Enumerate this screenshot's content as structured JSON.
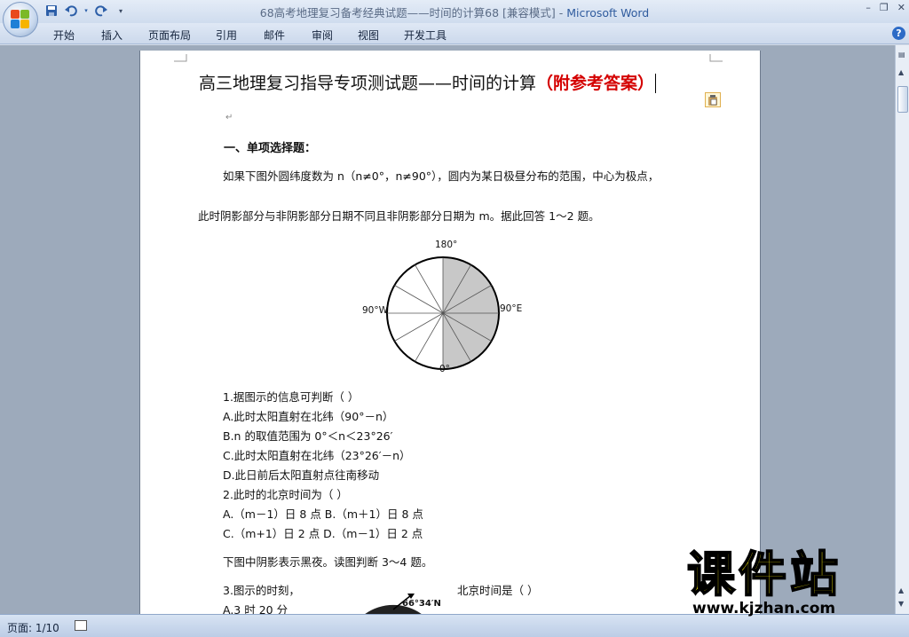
{
  "window": {
    "title": "68高考地理复习备考经典试题——时间的计算68 [兼容模式] - ",
    "app_name": "Microsoft Word",
    "minimize": "–",
    "restore": "❐",
    "close": "✕"
  },
  "ribbon": {
    "tabs": [
      "开始",
      "插入",
      "页面布局",
      "引用",
      "邮件",
      "审阅",
      "视图",
      "开发工具"
    ],
    "help": "?"
  },
  "document": {
    "title_main": "高三地理复习指导专项测试题——时间的计算",
    "title_answer": "（附参考答案）",
    "section1": "一、单项选择题：",
    "intro_line1": "如果下图外圆纬度数为 n（n≠0°，n≠90°），圆内为某日极昼分布的范围，中心为极点，",
    "intro_line2": "此时阴影部分与非阴影部分日期不同且非阴影部分日期为 m。据此回答 1～2 题。",
    "diagram_labels": {
      "top": "180°",
      "left": "90°W",
      "right": "90°E",
      "bottom": "0°"
    },
    "questions": [
      "1.据图示的信息可判断（      ）",
      "A.此时太阳直射在北纬（90°－n）",
      "B.n 的取值范围为 0°＜n＜23°26′",
      "C.此时太阳直射在北纬（23°26′－n）",
      "D.此日前后太阳直射点往南移动",
      "2.此时的北京时间为（     ）",
      "A.（m－1）日 8 点     B.（m＋1）日 8 点",
      "C.（m+1）日 2 点      D.（m－1）日 2 点"
    ],
    "intro2": "下图中阴影表示黑夜。读图判断 3～4 题。",
    "q3_left": "3.图示的时刻，",
    "q3_right": "北京时间是（    ）",
    "q3_a": "A.3 时 20 分",
    "diagram2_label": "66°34′N"
  },
  "statusbar": {
    "page": "页面: 1/10"
  },
  "watermark": {
    "text": "课件站",
    "url": "www.kjzhan.com"
  },
  "colors": {
    "answer_red": "#d40000",
    "watermark_yellow": "#f2e60a",
    "shade_gray": "#c8c8c8"
  }
}
